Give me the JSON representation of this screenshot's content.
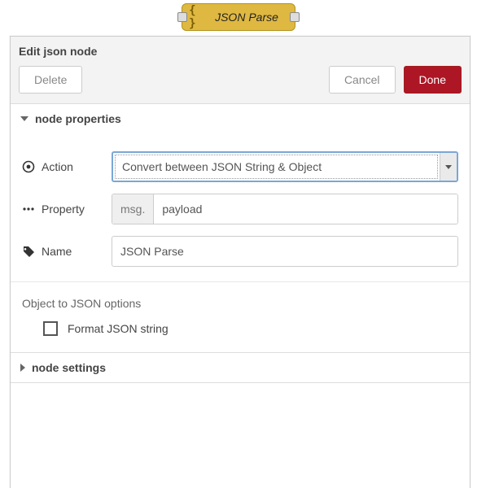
{
  "node": {
    "icon": "{ }",
    "label": "JSON Parse"
  },
  "editor": {
    "title": "Edit json node",
    "buttons": {
      "del": "Delete",
      "cancel": "Cancel",
      "done": "Done"
    },
    "sections": {
      "properties": "node properties",
      "settings": "node settings"
    },
    "fields": {
      "action": {
        "label": "Action",
        "value": "Convert between JSON String & Object"
      },
      "property": {
        "label": "Property",
        "prefix": "msg.",
        "value": "payload"
      },
      "name": {
        "label": "Name",
        "value": "JSON Parse"
      }
    },
    "objectToJson": {
      "heading": "Object to JSON options",
      "format": {
        "label": "Format JSON string",
        "checked": false
      }
    }
  }
}
